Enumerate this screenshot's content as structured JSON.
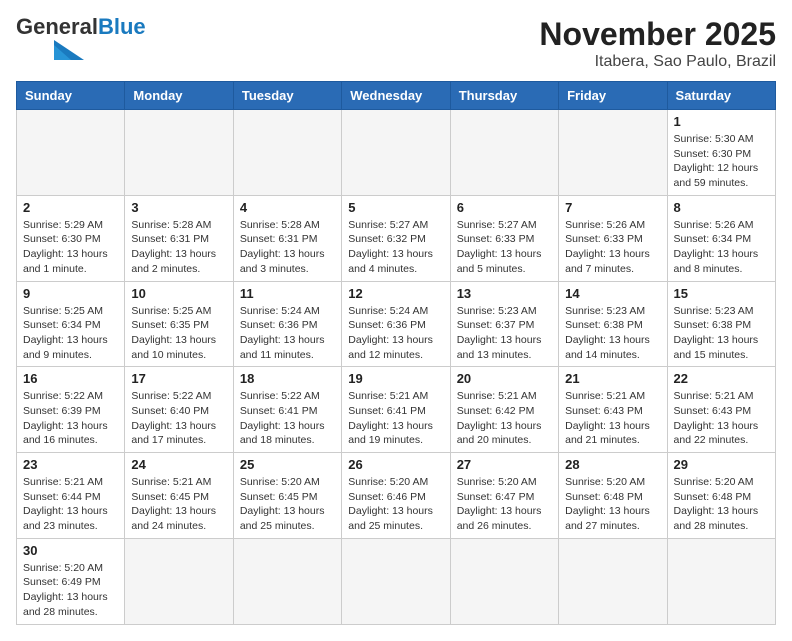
{
  "logo": {
    "line1": "General",
    "line2": "Blue"
  },
  "title": "November 2025",
  "location": "Itabera, Sao Paulo, Brazil",
  "days_header": [
    "Sunday",
    "Monday",
    "Tuesday",
    "Wednesday",
    "Thursday",
    "Friday",
    "Saturday"
  ],
  "weeks": [
    [
      {
        "num": "",
        "info": ""
      },
      {
        "num": "",
        "info": ""
      },
      {
        "num": "",
        "info": ""
      },
      {
        "num": "",
        "info": ""
      },
      {
        "num": "",
        "info": ""
      },
      {
        "num": "",
        "info": ""
      },
      {
        "num": "1",
        "info": "Sunrise: 5:30 AM\nSunset: 6:30 PM\nDaylight: 12 hours and 59 minutes."
      }
    ],
    [
      {
        "num": "2",
        "info": "Sunrise: 5:29 AM\nSunset: 6:30 PM\nDaylight: 13 hours and 1 minute."
      },
      {
        "num": "3",
        "info": "Sunrise: 5:28 AM\nSunset: 6:31 PM\nDaylight: 13 hours and 2 minutes."
      },
      {
        "num": "4",
        "info": "Sunrise: 5:28 AM\nSunset: 6:31 PM\nDaylight: 13 hours and 3 minutes."
      },
      {
        "num": "5",
        "info": "Sunrise: 5:27 AM\nSunset: 6:32 PM\nDaylight: 13 hours and 4 minutes."
      },
      {
        "num": "6",
        "info": "Sunrise: 5:27 AM\nSunset: 6:33 PM\nDaylight: 13 hours and 5 minutes."
      },
      {
        "num": "7",
        "info": "Sunrise: 5:26 AM\nSunset: 6:33 PM\nDaylight: 13 hours and 7 minutes."
      },
      {
        "num": "8",
        "info": "Sunrise: 5:26 AM\nSunset: 6:34 PM\nDaylight: 13 hours and 8 minutes."
      }
    ],
    [
      {
        "num": "9",
        "info": "Sunrise: 5:25 AM\nSunset: 6:34 PM\nDaylight: 13 hours and 9 minutes."
      },
      {
        "num": "10",
        "info": "Sunrise: 5:25 AM\nSunset: 6:35 PM\nDaylight: 13 hours and 10 minutes."
      },
      {
        "num": "11",
        "info": "Sunrise: 5:24 AM\nSunset: 6:36 PM\nDaylight: 13 hours and 11 minutes."
      },
      {
        "num": "12",
        "info": "Sunrise: 5:24 AM\nSunset: 6:36 PM\nDaylight: 13 hours and 12 minutes."
      },
      {
        "num": "13",
        "info": "Sunrise: 5:23 AM\nSunset: 6:37 PM\nDaylight: 13 hours and 13 minutes."
      },
      {
        "num": "14",
        "info": "Sunrise: 5:23 AM\nSunset: 6:38 PM\nDaylight: 13 hours and 14 minutes."
      },
      {
        "num": "15",
        "info": "Sunrise: 5:23 AM\nSunset: 6:38 PM\nDaylight: 13 hours and 15 minutes."
      }
    ],
    [
      {
        "num": "16",
        "info": "Sunrise: 5:22 AM\nSunset: 6:39 PM\nDaylight: 13 hours and 16 minutes."
      },
      {
        "num": "17",
        "info": "Sunrise: 5:22 AM\nSunset: 6:40 PM\nDaylight: 13 hours and 17 minutes."
      },
      {
        "num": "18",
        "info": "Sunrise: 5:22 AM\nSunset: 6:41 PM\nDaylight: 13 hours and 18 minutes."
      },
      {
        "num": "19",
        "info": "Sunrise: 5:21 AM\nSunset: 6:41 PM\nDaylight: 13 hours and 19 minutes."
      },
      {
        "num": "20",
        "info": "Sunrise: 5:21 AM\nSunset: 6:42 PM\nDaylight: 13 hours and 20 minutes."
      },
      {
        "num": "21",
        "info": "Sunrise: 5:21 AM\nSunset: 6:43 PM\nDaylight: 13 hours and 21 minutes."
      },
      {
        "num": "22",
        "info": "Sunrise: 5:21 AM\nSunset: 6:43 PM\nDaylight: 13 hours and 22 minutes."
      }
    ],
    [
      {
        "num": "23",
        "info": "Sunrise: 5:21 AM\nSunset: 6:44 PM\nDaylight: 13 hours and 23 minutes."
      },
      {
        "num": "24",
        "info": "Sunrise: 5:21 AM\nSunset: 6:45 PM\nDaylight: 13 hours and 24 minutes."
      },
      {
        "num": "25",
        "info": "Sunrise: 5:20 AM\nSunset: 6:45 PM\nDaylight: 13 hours and 25 minutes."
      },
      {
        "num": "26",
        "info": "Sunrise: 5:20 AM\nSunset: 6:46 PM\nDaylight: 13 hours and 25 minutes."
      },
      {
        "num": "27",
        "info": "Sunrise: 5:20 AM\nSunset: 6:47 PM\nDaylight: 13 hours and 26 minutes."
      },
      {
        "num": "28",
        "info": "Sunrise: 5:20 AM\nSunset: 6:48 PM\nDaylight: 13 hours and 27 minutes."
      },
      {
        "num": "29",
        "info": "Sunrise: 5:20 AM\nSunset: 6:48 PM\nDaylight: 13 hours and 28 minutes."
      }
    ],
    [
      {
        "num": "30",
        "info": "Sunrise: 5:20 AM\nSunset: 6:49 PM\nDaylight: 13 hours and 28 minutes."
      },
      {
        "num": "",
        "info": ""
      },
      {
        "num": "",
        "info": ""
      },
      {
        "num": "",
        "info": ""
      },
      {
        "num": "",
        "info": ""
      },
      {
        "num": "",
        "info": ""
      },
      {
        "num": "",
        "info": ""
      }
    ]
  ]
}
